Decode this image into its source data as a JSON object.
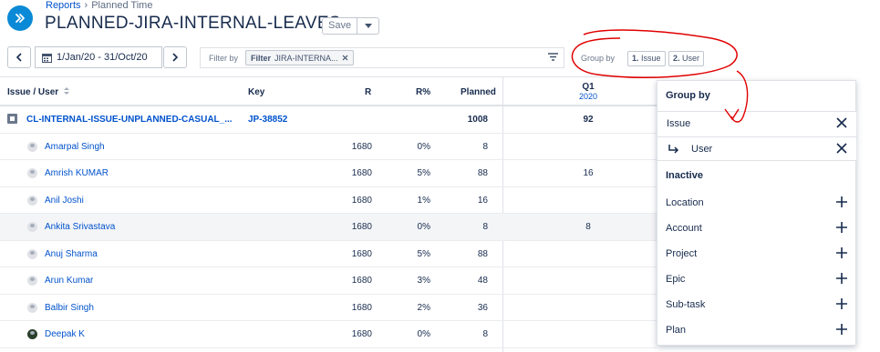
{
  "breadcrumb": {
    "root": "Reports",
    "separator": "›",
    "current": "Planned Time"
  },
  "page": {
    "title": "PLANNED-JIRA-INTERNAL-LEAVES",
    "save_label": "Save"
  },
  "toolbar": {
    "date_range": "1/Jan/20 - 31/Oct/20",
    "filter_label": "Filter by",
    "filter_chip_key": "Filter",
    "filter_chip_value": "JIRA-INTERNA...",
    "group_by_label": "Group by",
    "group_chips": [
      {
        "num": "1.",
        "label": "Issue"
      },
      {
        "num": "2.",
        "label": "User"
      }
    ]
  },
  "table": {
    "columns": {
      "issue_user": "Issue / User",
      "key": "Key",
      "r": "R",
      "r_pct": "R%",
      "planned": "Planned",
      "q1": "Q1",
      "q1_year": "2020"
    },
    "issue_row": {
      "name": "CL-INTERNAL-ISSUE-UNPLANNED-CASUAL_...",
      "key": "JP-38852",
      "planned": "1008",
      "q1": "92"
    },
    "user_rows": [
      {
        "name": "Amarpal Singh",
        "r": "1680",
        "r_pct": "0%",
        "planned": "8",
        "q1": ""
      },
      {
        "name": "Amrish KUMAR",
        "r": "1680",
        "r_pct": "5%",
        "planned": "88",
        "q1": "16"
      },
      {
        "name": "Anil Joshi",
        "r": "1680",
        "r_pct": "1%",
        "planned": "16",
        "q1": ""
      },
      {
        "name": "Ankita Srivastava",
        "r": "1680",
        "r_pct": "0%",
        "planned": "8",
        "q1": "8"
      },
      {
        "name": "Anuj Sharma",
        "r": "1680",
        "r_pct": "5%",
        "planned": "88",
        "q1": ""
      },
      {
        "name": "Arun Kumar",
        "r": "1680",
        "r_pct": "3%",
        "planned": "48",
        "q1": ""
      },
      {
        "name": "Balbir Singh",
        "r": "1680",
        "r_pct": "2%",
        "planned": "36",
        "q1": ""
      },
      {
        "name": "Deepak K",
        "r": "1680",
        "r_pct": "0%",
        "planned": "8",
        "q1": ""
      }
    ]
  },
  "group_by_panel": {
    "title": "Group by",
    "active": [
      "Issue",
      "User"
    ],
    "inactive_title": "Inactive",
    "inactive": [
      "Location",
      "Account",
      "Project",
      "Epic",
      "Sub-task",
      "Plan"
    ]
  },
  "colors": {
    "accent": "#0052cc",
    "logo": "#0a8ad6",
    "annotation": "#e00000"
  }
}
